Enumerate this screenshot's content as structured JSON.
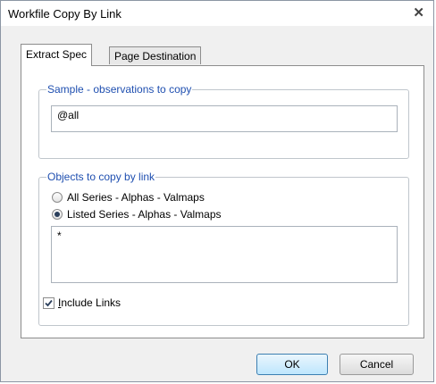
{
  "window": {
    "title": "Workfile Copy By Link"
  },
  "tabs": [
    {
      "label": "Extract Spec",
      "active": true
    },
    {
      "label": "Page Destination",
      "active": false
    }
  ],
  "sample_group": {
    "legend": "Sample - observations to copy",
    "value": "@all"
  },
  "objects_group": {
    "legend": "Objects to copy by link",
    "radio_all": "All Series - Alphas - Valmaps",
    "radio_listed": "Listed Series -  Alphas - Valmaps",
    "selected": "listed",
    "list_value": "*"
  },
  "include_links": {
    "label_rest": "nclude Links",
    "accel": "I",
    "checked": true
  },
  "buttons": {
    "ok": "OK",
    "cancel": "Cancel"
  },
  "colors": {
    "accent_text": "#1f4fb0",
    "default_button_border": "#3c7fb1"
  }
}
